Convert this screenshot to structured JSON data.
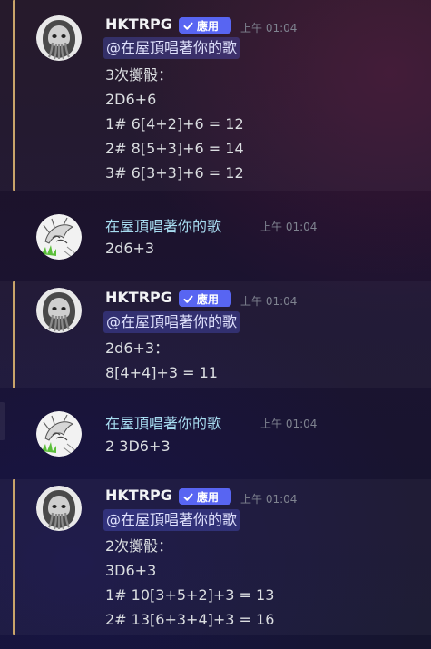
{
  "messages": [
    {
      "author": "HKTRPG",
      "badge": "應用",
      "time": "上午 01:04",
      "mention": "@在屋頂唱著你的歌",
      "lines": [
        "3次擲骰：",
        "2D6+6",
        "1# 6[4+2]+6 = 12",
        "2# 8[5+3]+6 = 14",
        "3# 6[3+3]+6 = 12"
      ]
    },
    {
      "author": "在屋頂唱著你的歌",
      "time": "上午 01:04",
      "lines": [
        "2d6+3"
      ]
    },
    {
      "author": "HKTRPG",
      "badge": "應用",
      "time": "上午 01:04",
      "mention": "@在屋頂唱著你的歌",
      "lines": [
        "2d6+3：",
        "8[4+4]+3 = 11"
      ]
    },
    {
      "author": "在屋頂唱著你的歌",
      "time": "上午 01:04",
      "lines": [
        "2 3D6+3"
      ]
    },
    {
      "author": "HKTRPG",
      "badge": "應用",
      "time": "上午 01:04",
      "mention": "@在屋頂唱著你的歌",
      "lines": [
        "2次擲骰：",
        "3D6+3",
        "1# 10[3+5+2]+3 = 13",
        "2# 13[6+3+4]+3 = 16"
      ]
    }
  ],
  "icons": {
    "bot_avatar": "hooded-cthulhu-avatar",
    "user_avatar": "sketch-character-avatar",
    "verified": "checkmark-icon"
  },
  "colors": {
    "mention_bar": "#c9a46a",
    "badge": "#5865f2",
    "user_name": "#a7dcf0"
  }
}
